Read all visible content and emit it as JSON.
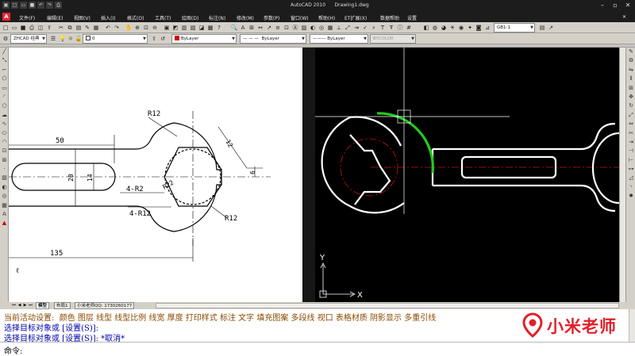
{
  "window": {
    "app_title": "AutoCAD 2010",
    "file_name": "Drawing1.dwg",
    "controls": [
      "minimize",
      "maximize",
      "close"
    ]
  },
  "quick_access": [
    "new-icon",
    "open-icon",
    "save-icon",
    "undo-icon",
    "redo-icon",
    "plot-icon"
  ],
  "menu": [
    "文件(F)",
    "编辑(E)",
    "视图(V)",
    "插入(I)",
    "格式(O)",
    "工具(T)",
    "绘图(D)",
    "标注(N)",
    "修改(M)",
    "参数(P)",
    "窗口(W)",
    "帮助(H)",
    "ET扩展(X)",
    "数据帮助",
    "设置"
  ],
  "toolbar": {
    "workspace": "ZHCAD 经典",
    "layer_name": "0",
    "color_value": "ByLayer",
    "linetype_value": "ByLayer",
    "lineweight_value": "ByLayer",
    "plotstyle_value": "BYCOLOR",
    "dimstyle_value": "GB1-1"
  },
  "reference_drawing": {
    "dim_50": "50",
    "dim_20": "20",
    "dim_14": "14",
    "dim_135": "135",
    "label_r12_top": "R12",
    "label_r12_bottom": "R12",
    "label_r22": "R22",
    "label_4r2": "4-R2",
    "label_4r12": "4-R12",
    "label_12": "12",
    "label_6": "6",
    "corner_mark": "ℓ"
  },
  "viewport": {
    "ucs_x": "X",
    "ucs_y": "Y",
    "colors": {
      "background": "#000000",
      "object_lines": "#ffffff",
      "selected_arc": "#22cc22",
      "center_lines": "#cc1111"
    }
  },
  "layout_tabs": {
    "model": "模型",
    "layout1": "布局1",
    "extra": "小米老师QQ: 1730260177"
  },
  "command": {
    "history_1": "当前活动设置:  颜色 图层 线型 线型比例 线宽 厚度 打印样式 标注 文字 填充图案 多段线 视口 表格材质 阴影显示 多重引线",
    "history_2": "选择目标对象或 [设置(S)]:",
    "history_3": "选择目标对象或 [设置(S)]: *取消*",
    "prompt": "命令:"
  },
  "watermark": {
    "text": "小米老师",
    "color": "#e0202a"
  }
}
